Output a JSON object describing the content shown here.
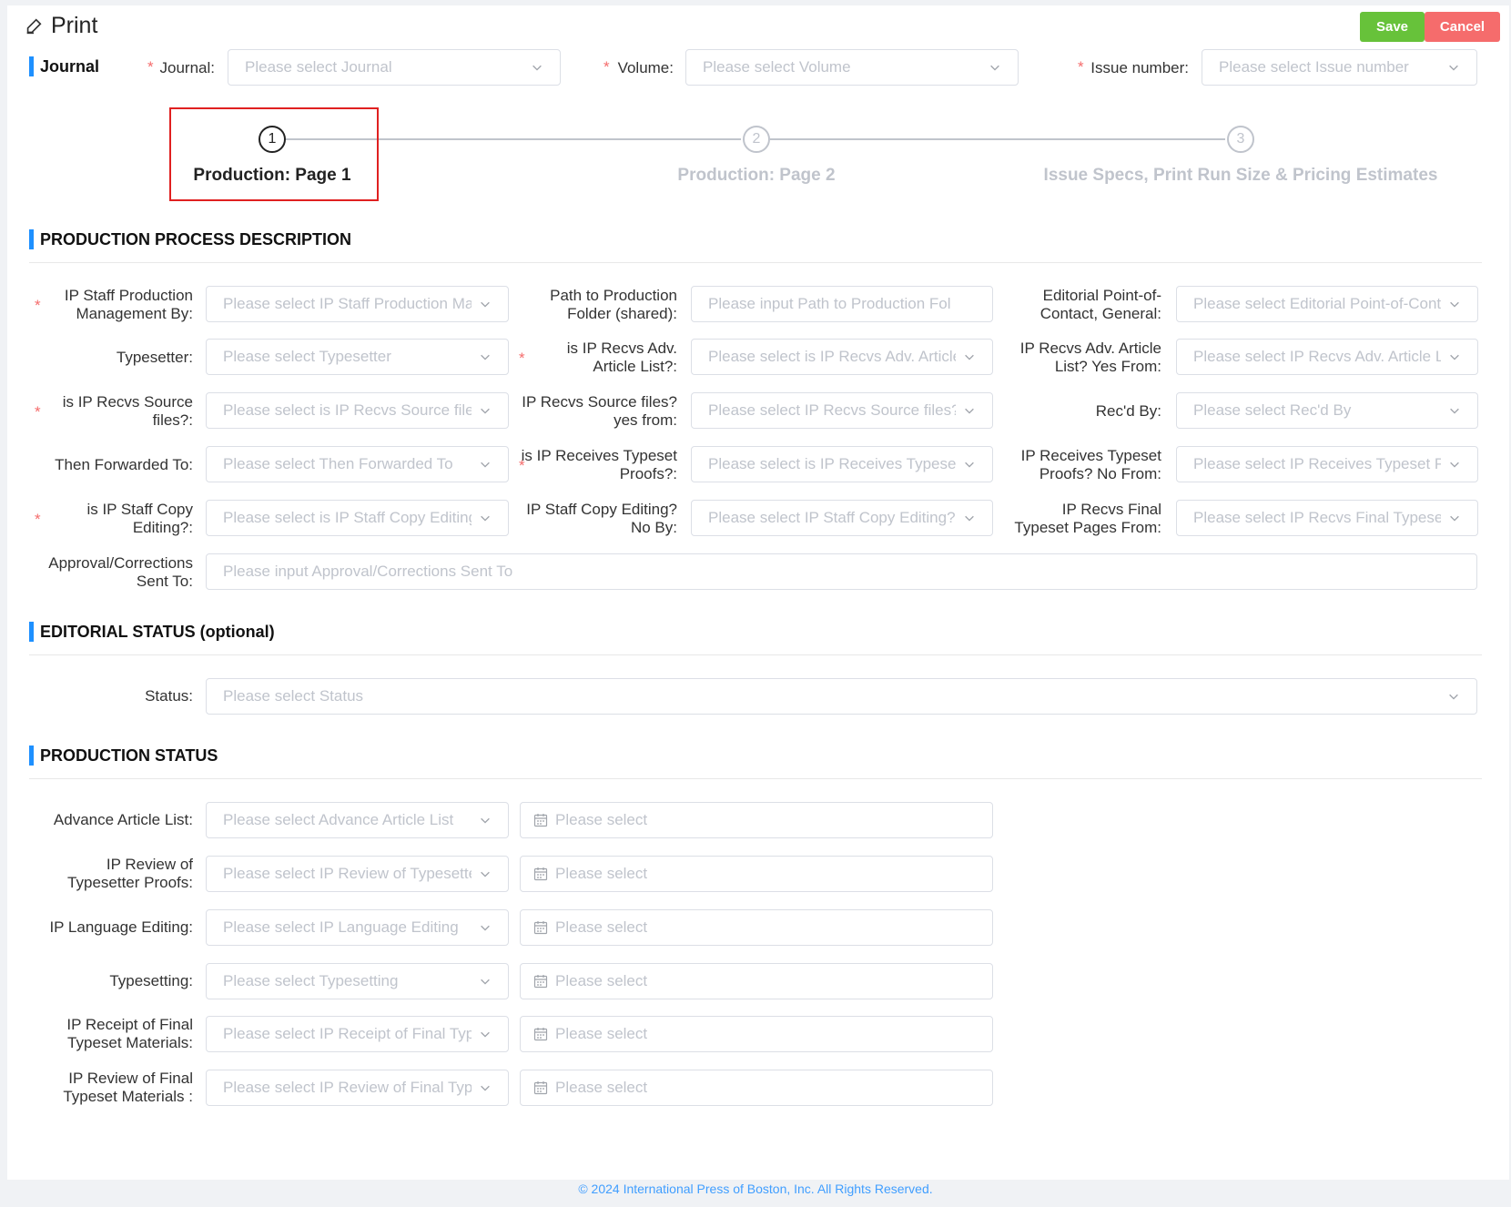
{
  "header": {
    "title": "Print",
    "save_label": "Save",
    "cancel_label": "Cancel",
    "journal_section": "Journal",
    "journal_label": "Journal:",
    "journal_placeholder": "Please select Journal",
    "volume_label": "Volume:",
    "volume_placeholder": "Please select Volume",
    "issue_label": "Issue number:",
    "issue_placeholder": "Please select Issue number"
  },
  "steps": [
    {
      "num": "1",
      "label": "Production: Page 1"
    },
    {
      "num": "2",
      "label": "Production: Page 2"
    },
    {
      "num": "3",
      "label": "Issue Specs, Print Run Size & Pricing Estimates"
    }
  ],
  "production_process": {
    "heading": "PRODUCTION PROCESS DESCRIPTION",
    "fields": [
      {
        "label": "IP Staff Production Management By:",
        "placeholder": "Please select IP Staff Production Ma"
      },
      {
        "label": "Path to Production Folder (shared):",
        "placeholder": "Please input Path to Production Fol"
      },
      {
        "label": "Editorial Point-of-Contact, General:",
        "placeholder": "Please select Editorial Point-of-Cont"
      },
      {
        "label": "Typesetter:",
        "placeholder": "Please select Typesetter"
      },
      {
        "label": "is IP Recvs Adv. Article List?:",
        "placeholder": "Please select is IP Recvs Adv. Article"
      },
      {
        "label": "IP Recvs Adv. Article List? Yes From:",
        "placeholder": "Please select IP Recvs Adv. Article Li"
      },
      {
        "label": "is IP Recvs Source files?:",
        "placeholder": "Please select is IP Recvs Source files"
      },
      {
        "label": "IP Recvs Source files? yes from:",
        "placeholder": "Please select IP Recvs Source files? y"
      },
      {
        "label": "Rec'd By:",
        "placeholder": "Please select Rec'd By"
      },
      {
        "label": "Then Forwarded To:",
        "placeholder": "Please select Then Forwarded To"
      },
      {
        "label": "is IP Receives Typeset Proofs?:",
        "placeholder": "Please select is IP Receives Typeset I"
      },
      {
        "label": "IP Receives Typeset Proofs? No From:",
        "placeholder": "Please select IP Receives Typeset Pro"
      },
      {
        "label": "is IP Staff Copy Editing?:",
        "placeholder": "Please select is IP Staff Copy Editing"
      },
      {
        "label": "IP Staff Copy Editing? No By:",
        "placeholder": "Please select IP Staff Copy Editing?"
      },
      {
        "label": "IP Recvs Final Typeset Pages From:",
        "placeholder": "Please select IP Recvs Final Typeset"
      },
      {
        "label": "Approval/Corrections Sent To:",
        "placeholder": "Please input Approval/Corrections Sent To"
      }
    ]
  },
  "editorial_status": {
    "heading": "EDITORIAL STATUS (optional)",
    "status_label": "Status:",
    "status_placeholder": "Please select Status"
  },
  "production_status": {
    "heading": "PRODUCTION STATUS",
    "date_placeholder": "Please select",
    "rows": [
      {
        "label": "Advance Article List:",
        "placeholder": "Please select Advance Article List"
      },
      {
        "label": "IP Review of Typesetter Proofs:",
        "placeholder": "Please select IP Review of Typesette"
      },
      {
        "label": "IP Language Editing:",
        "placeholder": "Please select IP Language Editing"
      },
      {
        "label": "Typesetting:",
        "placeholder": "Please select Typesetting"
      },
      {
        "label": "IP Receipt of Final Typeset Materials:",
        "placeholder": "Please select IP Receipt of Final Typ"
      },
      {
        "label": "IP Review of Final Typeset Materials :",
        "placeholder": "Please select IP Review of Final Type"
      }
    ]
  },
  "footer": {
    "text": "© 2024 International Press of Boston, Inc. All Rights Reserved."
  }
}
